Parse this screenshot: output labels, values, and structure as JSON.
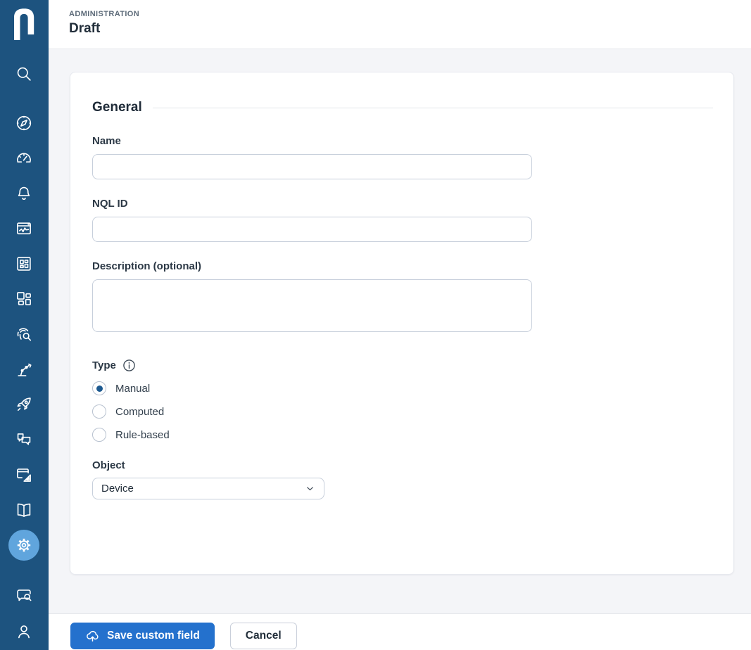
{
  "colors": {
    "sidebar-bg": "#1d537f",
    "sidebar-active-bg": "#60a5dd",
    "accent": "#2471cd",
    "radio-dot": "#1d5a90",
    "page-bg": "#f4f5f8"
  },
  "sidebar": {
    "logo": "nexthink-logo",
    "active_item": "settings",
    "items": [
      {
        "name": "search"
      },
      {
        "name": "discover-compass"
      },
      {
        "name": "dashboards-gauge"
      },
      {
        "name": "alerts-bell"
      },
      {
        "name": "monitoring-chart-window"
      },
      {
        "name": "applications-grid"
      },
      {
        "name": "workspace-layout"
      },
      {
        "name": "investigation-fingerprint-search"
      },
      {
        "name": "automation-robot-arm"
      },
      {
        "name": "launch-rocket"
      },
      {
        "name": "engage-chat-bubbles"
      },
      {
        "name": "remediation-design-window"
      },
      {
        "name": "library-book"
      },
      {
        "name": "settings-gear"
      },
      {
        "name": "support-chat-search"
      },
      {
        "name": "profile-person"
      }
    ]
  },
  "header": {
    "eyebrow": "ADMINISTRATION",
    "title": "Draft"
  },
  "form": {
    "section_title": "General",
    "fields": {
      "name": {
        "label": "Name",
        "value": ""
      },
      "nql_id": {
        "label": "NQL ID",
        "value": ""
      },
      "description": {
        "label": "Description (optional)",
        "value": ""
      }
    },
    "type": {
      "label": "Type",
      "info_icon": "info-icon",
      "options": [
        {
          "label": "Manual",
          "selected": true
        },
        {
          "label": "Computed",
          "selected": false
        },
        {
          "label": "Rule-based",
          "selected": false
        }
      ]
    },
    "object": {
      "label": "Object",
      "value": "Device"
    }
  },
  "footer": {
    "save_label": "Save custom field",
    "save_icon": "cloud-upload-icon",
    "cancel_label": "Cancel"
  }
}
